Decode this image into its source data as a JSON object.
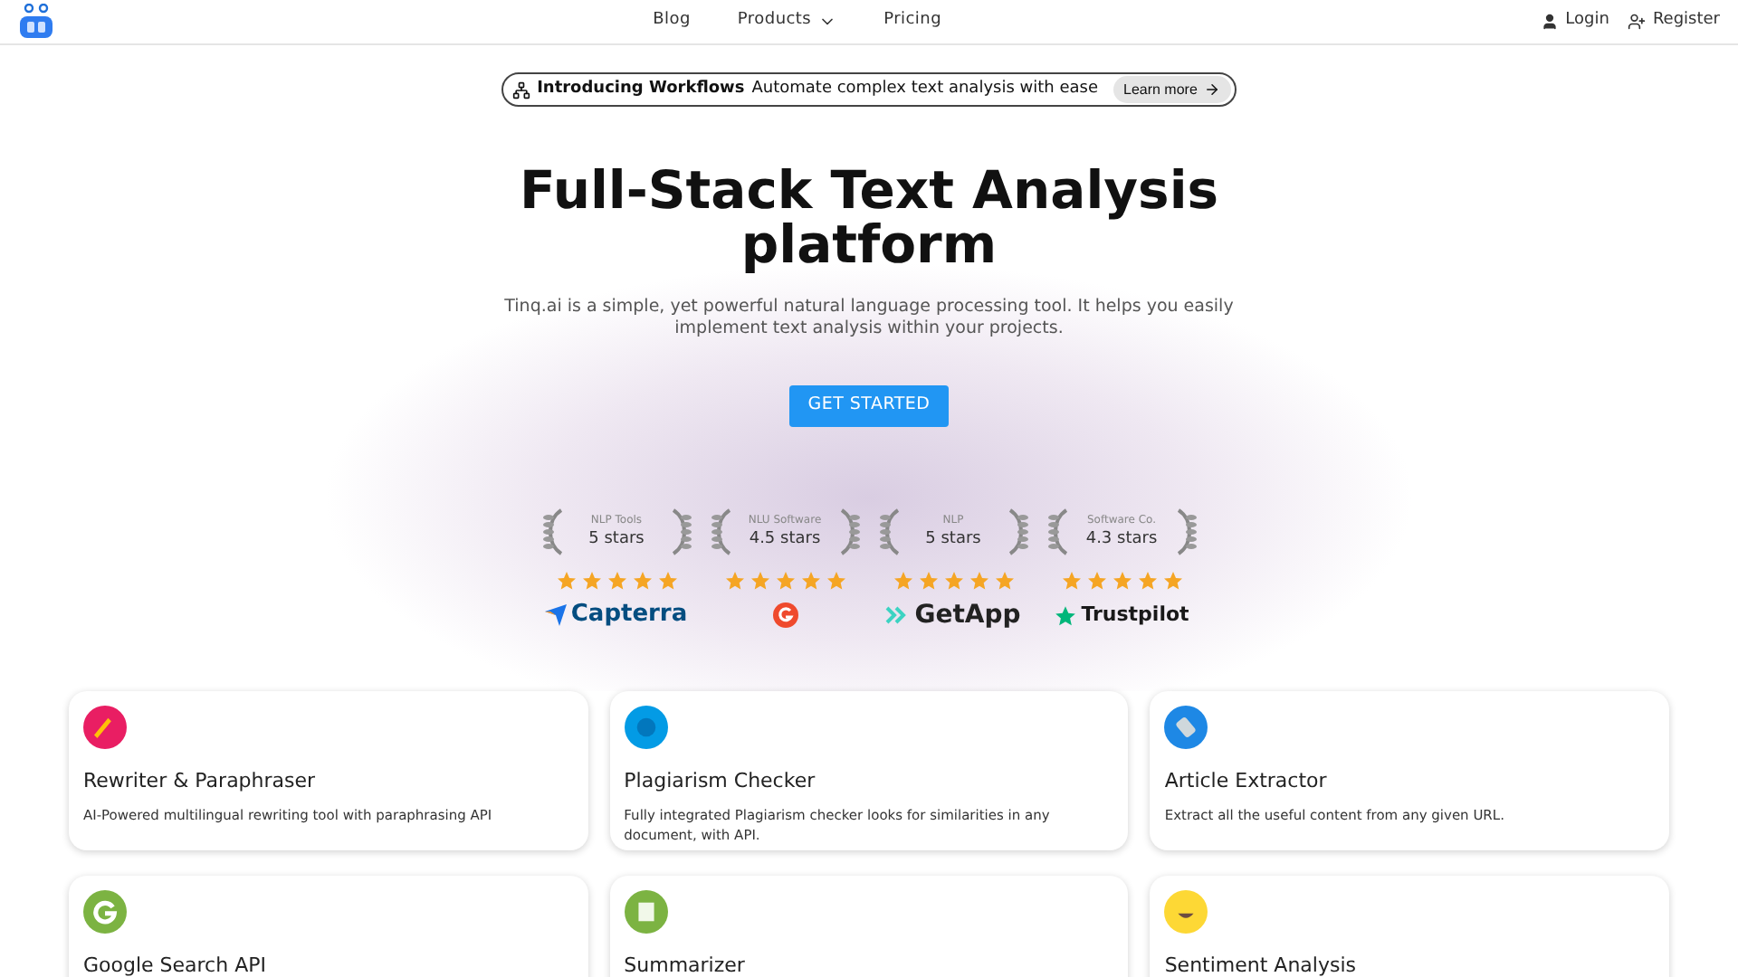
{
  "nav": {
    "links": [
      {
        "label": "Blog",
        "dropdown": false
      },
      {
        "label": "Products",
        "dropdown": true
      },
      {
        "label": "Pricing",
        "dropdown": false
      }
    ],
    "login": "Login",
    "register": "Register"
  },
  "banner": {
    "title": "Introducing Workflows",
    "text": "Automate complex text analysis with ease",
    "button": "Learn more"
  },
  "hero": {
    "title": "Full-Stack Text Analysis platform",
    "description": "Tinq.ai is a simple, yet powerful natural language processing tool. It helps you easily implement text analysis within your projects.",
    "cta": "GET STARTED"
  },
  "ratings": [
    {
      "category": "NLP Tools",
      "score": "5 stars",
      "stars": 5,
      "kind": "capterra",
      "brand": "Capterra"
    },
    {
      "category": "NLU Software",
      "score": "4.5 stars",
      "stars": 5,
      "kind": "g2"
    },
    {
      "category": "NLP",
      "score": "5 stars",
      "stars": 5,
      "kind": "getapp",
      "brand": "GetApp"
    },
    {
      "category": "Software Co.",
      "score": "4.3 stars",
      "stars": 5,
      "kind": "trustpilot",
      "brand": "Trustpilot"
    }
  ],
  "tools": [
    {
      "title": "Rewriter & Paraphraser",
      "description": "AI-Powered multilingual rewriting tool with paraphrasing API",
      "kind": "pen",
      "color": "#e91e63"
    },
    {
      "title": "Plagiarism Checker",
      "description": "Fully integrated Plagiarism checker looks for similarities in any document, with API.",
      "kind": "globe",
      "color": "#039be5"
    },
    {
      "title": "Article Extractor",
      "description": "Extract all the useful content from any given URL.",
      "kind": "tool",
      "color": "#1e88e5"
    },
    {
      "title": "Google Search API",
      "kind": "google",
      "color": "#7cb342"
    },
    {
      "title": "Summarizer",
      "kind": "doc",
      "color": "#7cb342"
    },
    {
      "title": "Sentiment Analysis",
      "kind": "smile",
      "color": "#fdd835"
    }
  ]
}
